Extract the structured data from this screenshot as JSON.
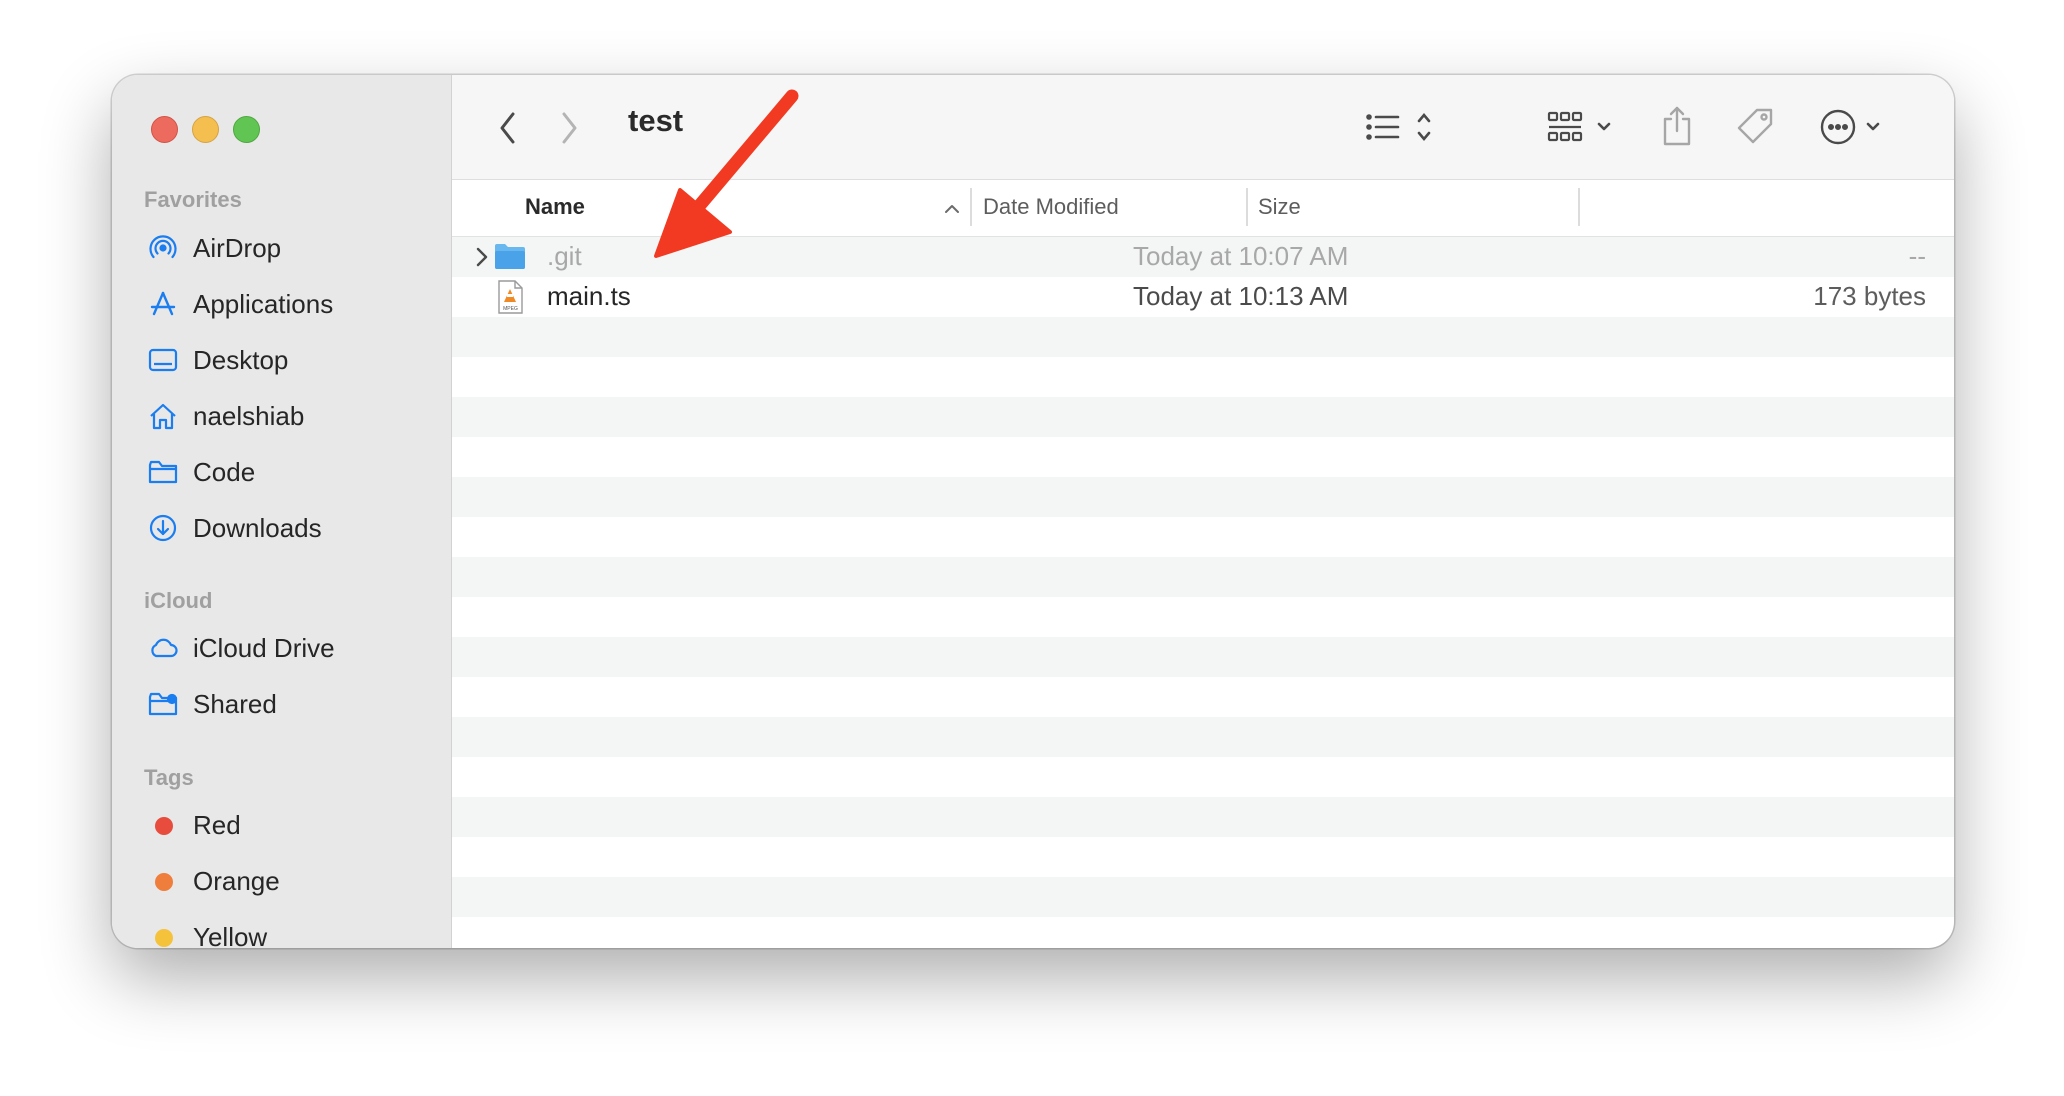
{
  "window": {
    "title": "test"
  },
  "sidebar": {
    "sections": [
      {
        "title": "Favorites",
        "items": [
          {
            "label": "AirDrop",
            "icon": "airdrop-icon"
          },
          {
            "label": "Applications",
            "icon": "applications-icon"
          },
          {
            "label": "Desktop",
            "icon": "desktop-icon"
          },
          {
            "label": "naelshiab",
            "icon": "home-icon"
          },
          {
            "label": "Code",
            "icon": "folder-icon"
          },
          {
            "label": "Downloads",
            "icon": "downloads-icon"
          }
        ]
      },
      {
        "title": "iCloud",
        "items": [
          {
            "label": "iCloud Drive",
            "icon": "cloud-icon"
          },
          {
            "label": "Shared",
            "icon": "shared-folder-icon"
          }
        ]
      },
      {
        "title": "Tags",
        "items": [
          {
            "label": "Red",
            "color": "#e74c3c"
          },
          {
            "label": "Orange",
            "color": "#ef7d3c"
          },
          {
            "label": "Yellow",
            "color": "#f5c33b"
          }
        ]
      }
    ]
  },
  "columns": {
    "name": "Name",
    "date": "Date Modified",
    "size": "Size"
  },
  "files": [
    {
      "name": ".git",
      "date": "Today at 10:07 AM",
      "size": "--",
      "kind": "folder",
      "hidden": true
    },
    {
      "name": "main.ts",
      "date": "Today at 10:13 AM",
      "size": "173 bytes",
      "kind": "file",
      "icon_badge": "MPEG"
    }
  ],
  "colors": {
    "accent": "#1a7df0",
    "annotation_arrow": "#f23a22"
  }
}
